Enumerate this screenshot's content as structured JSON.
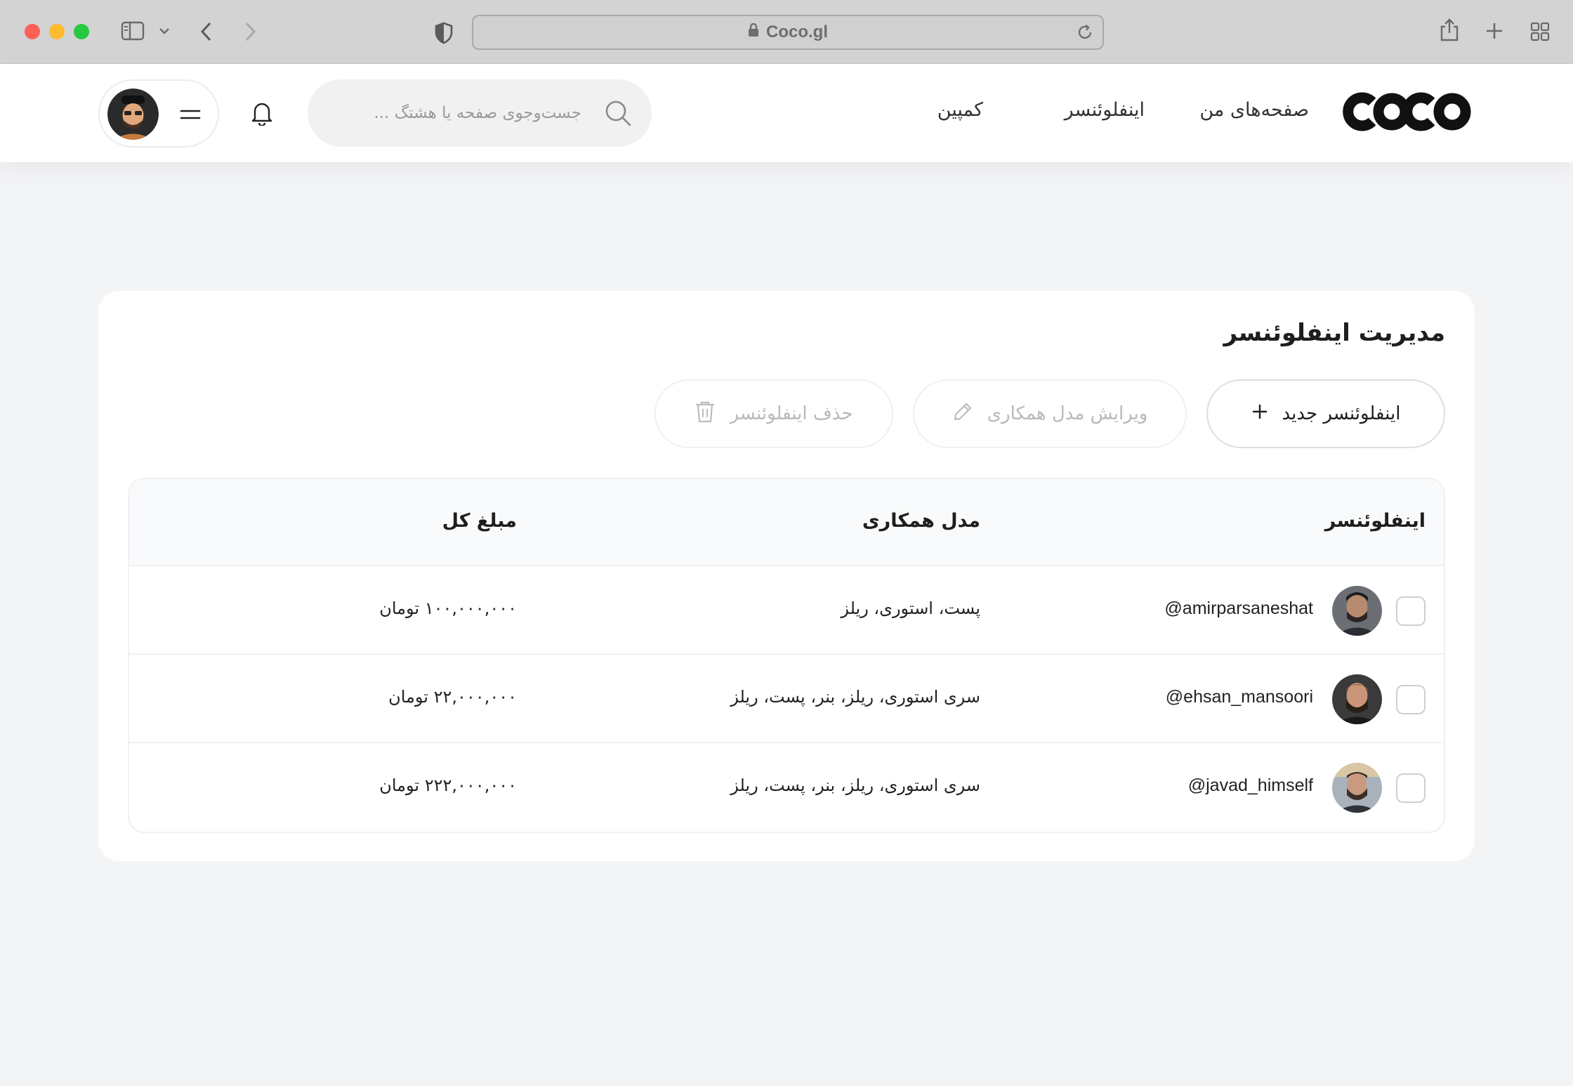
{
  "browser": {
    "url": "Coco.gl",
    "icons": [
      "sidebar-icon",
      "chevron-down-icon",
      "back-icon",
      "forward-icon",
      "shield-icon",
      "lock-icon",
      "reload-icon",
      "share-icon",
      "plus-icon",
      "tabs-grid-icon"
    ]
  },
  "header": {
    "logo": "coco",
    "nav": {
      "my_pages": "صفحه‌های من",
      "influencer": "اینفلوئنسر",
      "campaign": "کمپین"
    },
    "search": {
      "placeholder": "جست‌وجوی صفحه یا هشتگ ..."
    }
  },
  "main": {
    "title": "مدیریت اینفلوئنسر",
    "buttons": {
      "new_influencer": "اینفلوئنسر جدید",
      "edit_model": "ویرایش مدل همکاری",
      "delete_influencer": "حذف اینفلوئنسر"
    },
    "table": {
      "columns": {
        "influencer": "اینفلوئنسر",
        "model": "مدل همکاری",
        "amount": "مبلغ کل"
      },
      "rows": [
        {
          "handle": "@amirparsaneshat",
          "model": "پست، استوری، ریلز",
          "amount": "۱۰۰,۰۰۰,۰۰۰ تومان",
          "checked": false
        },
        {
          "handle": "@ehsan_mansoori",
          "model": "سری استوری، ریلز، بنر، پست، ریلز",
          "amount": "۲۲,۰۰۰,۰۰۰ تومان",
          "checked": false
        },
        {
          "handle": "@javad_himself",
          "model": "سری استوری، ریلز، بنر، پست، ریلز",
          "amount": "۲۲۲,۰۰۰,۰۰۰ تومان",
          "checked": false
        }
      ]
    }
  },
  "colors": {
    "page_bg": "#f3f4f6",
    "card_bg": "#ffffff",
    "text": "#1e1e1e",
    "muted": "#b9b9b9",
    "chrome_bg": "#d3d3d3"
  }
}
